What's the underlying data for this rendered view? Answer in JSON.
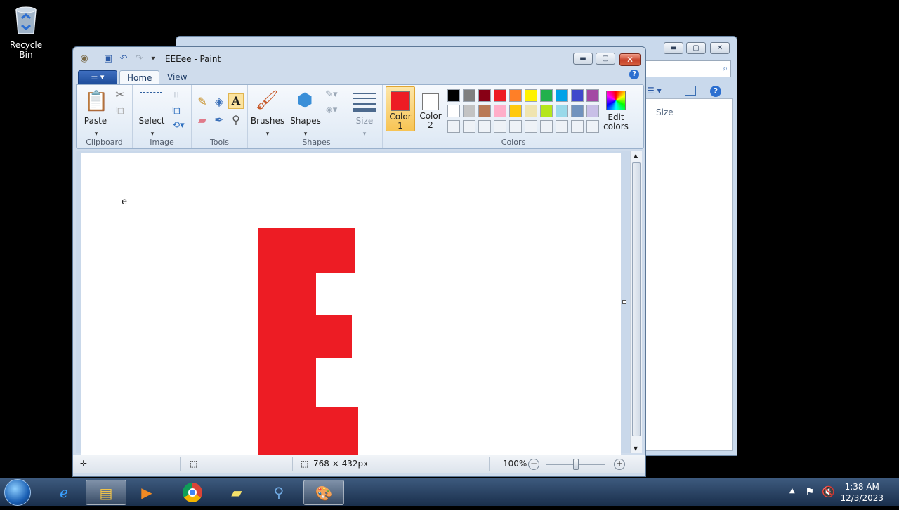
{
  "desktop": {
    "recycle_bin_label": "Recycle Bin"
  },
  "explorer": {
    "column_header": "Size"
  },
  "paint": {
    "title": "EEEee - Paint",
    "tabs": {
      "home": "Home",
      "view": "View"
    },
    "ribbon": {
      "paste_label": "Paste",
      "select_label": "Select",
      "brushes_label": "Brushes",
      "shapes_label": "Shapes",
      "size_label": "Size",
      "color1_label_line1": "Color",
      "color1_label_line2": "1",
      "color2_label_line1": "Color",
      "color2_label_line2": "2",
      "edit_colors_line1": "Edit",
      "edit_colors_line2": "colors",
      "groups": {
        "clipboard": "Clipboard",
        "image": "Image",
        "tools": "Tools",
        "shapes": "Shapes",
        "colors": "Colors"
      },
      "color1": "#ed1c24",
      "color2": "#ffffff",
      "palette_row1": [
        "#000000",
        "#7f7f7f",
        "#880015",
        "#ed1c24",
        "#ff7f27",
        "#fff200",
        "#22b14c",
        "#00a2e8",
        "#3f48cc",
        "#a349a4"
      ],
      "palette_row2": [
        "#ffffff",
        "#c3c3c3",
        "#b97a57",
        "#ffaec9",
        "#ffc90e",
        "#efe4b0",
        "#b5e61d",
        "#99d9ea",
        "#7092be",
        "#c8bfe7"
      ]
    },
    "canvas": {
      "text": "e",
      "shape_color": "#ed1c24"
    },
    "status": {
      "dimensions": "768 × 432px",
      "zoom": "100%"
    }
  },
  "taskbar": {
    "time": "1:38 AM",
    "date": "12/3/2023"
  }
}
